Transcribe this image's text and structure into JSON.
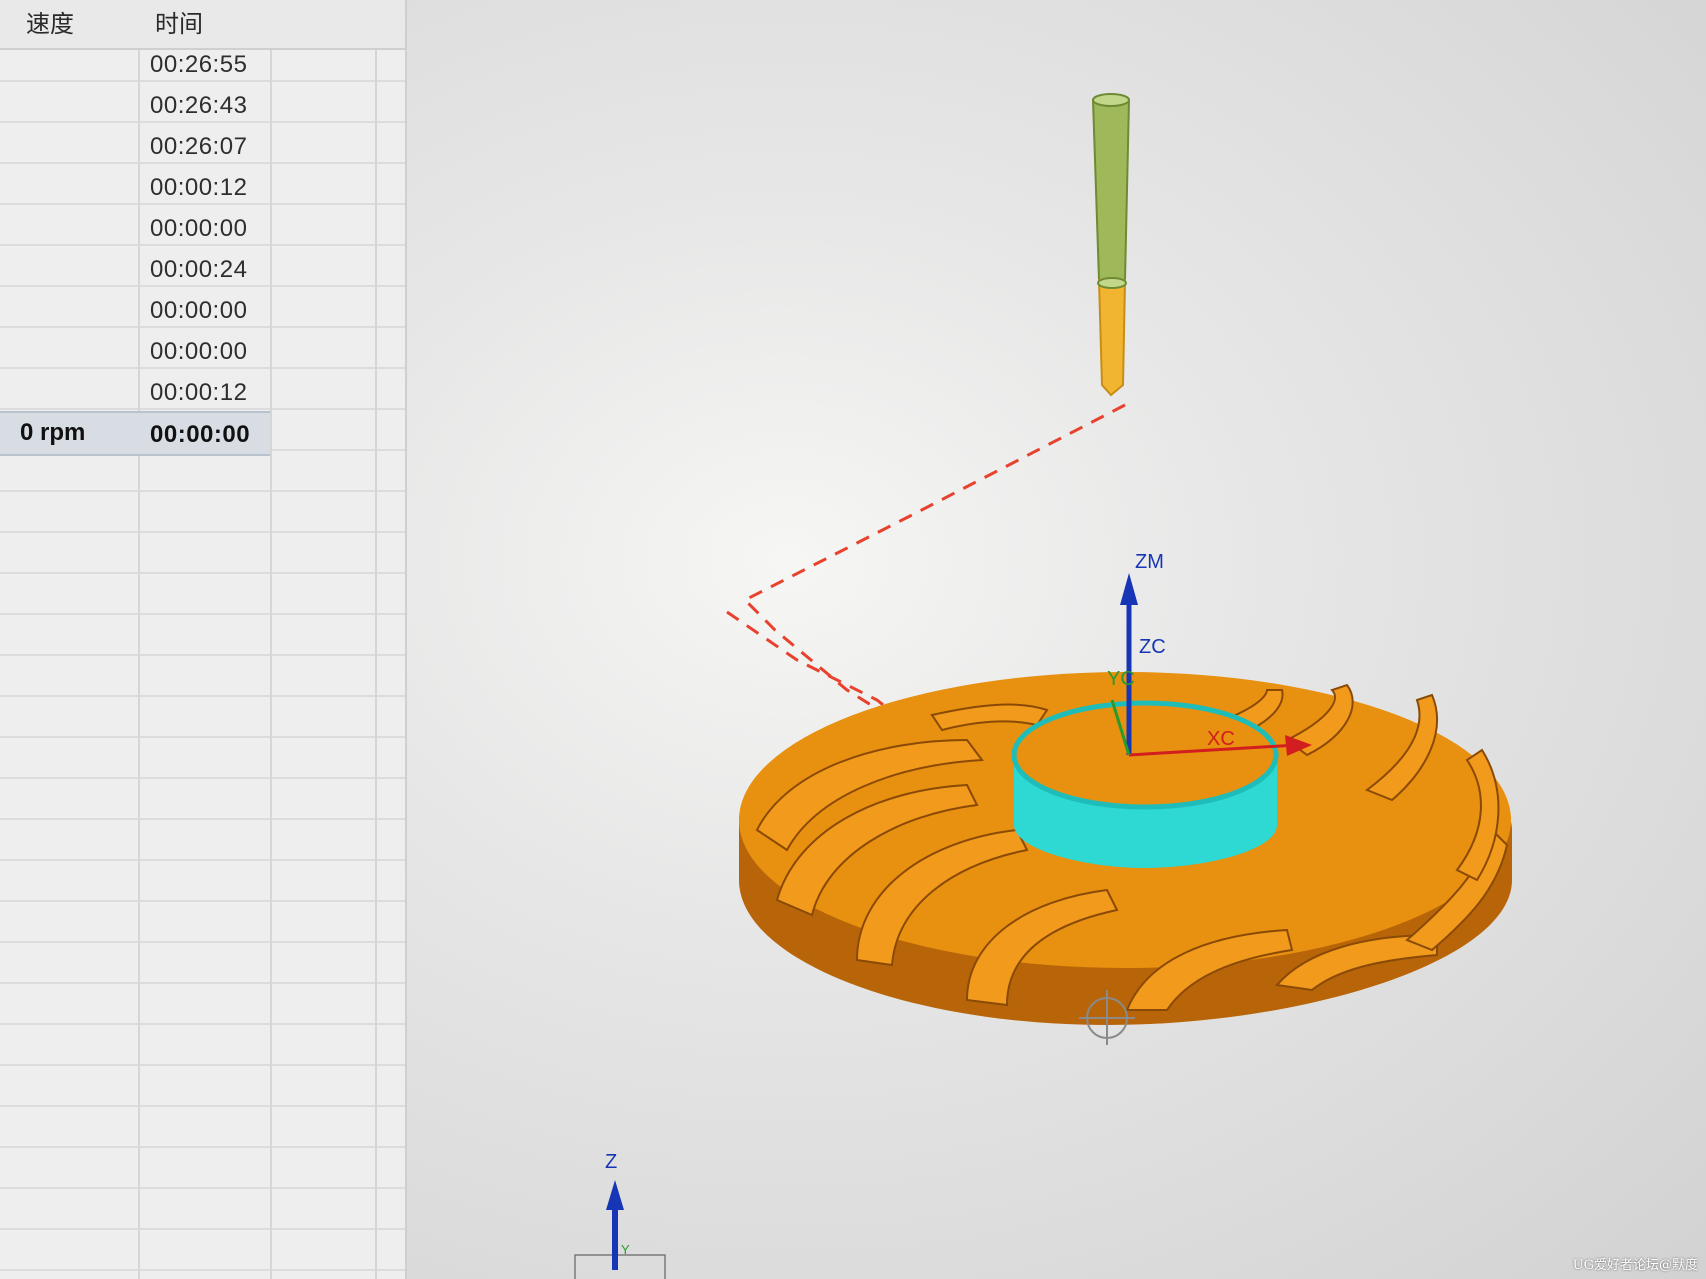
{
  "table": {
    "headers": {
      "speed": "速度",
      "time": "时间"
    },
    "rows": [
      {
        "speed": "",
        "time": "00:26:55"
      },
      {
        "speed": "",
        "time": "00:26:43"
      },
      {
        "speed": "",
        "time": "00:26:07"
      },
      {
        "speed": "",
        "time": "00:00:12"
      },
      {
        "speed": "",
        "time": "00:00:00"
      },
      {
        "speed": "",
        "time": "00:00:24"
      },
      {
        "speed": "",
        "time": "00:00:00"
      },
      {
        "speed": "",
        "time": "00:00:00"
      },
      {
        "speed": "",
        "time": "00:00:12"
      },
      {
        "speed": "0 rpm",
        "time": "00:00:00"
      }
    ],
    "selected_row_index": 9
  },
  "viewport": {
    "axes": {
      "work_zm": "ZM",
      "work_zc": "ZC",
      "work_yc": "YC",
      "work_xc": "XC",
      "absolute_z": "Z",
      "absolute_y": "Y"
    },
    "colors": {
      "part": "#e8900f",
      "part_dark": "#b8650a",
      "hub_top": "#ffffff",
      "hub_side": "#2ed8d3",
      "tool_holder": "#9fb85a",
      "tool_cutter": "#f2b531",
      "toolpath": "#e8422e",
      "axis_blue": "#1736b5",
      "axis_red": "#d21e1e",
      "axis_green": "#2a9a2a"
    },
    "icons": [
      "wcs-origin-icon",
      "absolute-csys-icon",
      "tool-icon"
    ]
  },
  "watermark": "UG爱好者论坛@默度"
}
